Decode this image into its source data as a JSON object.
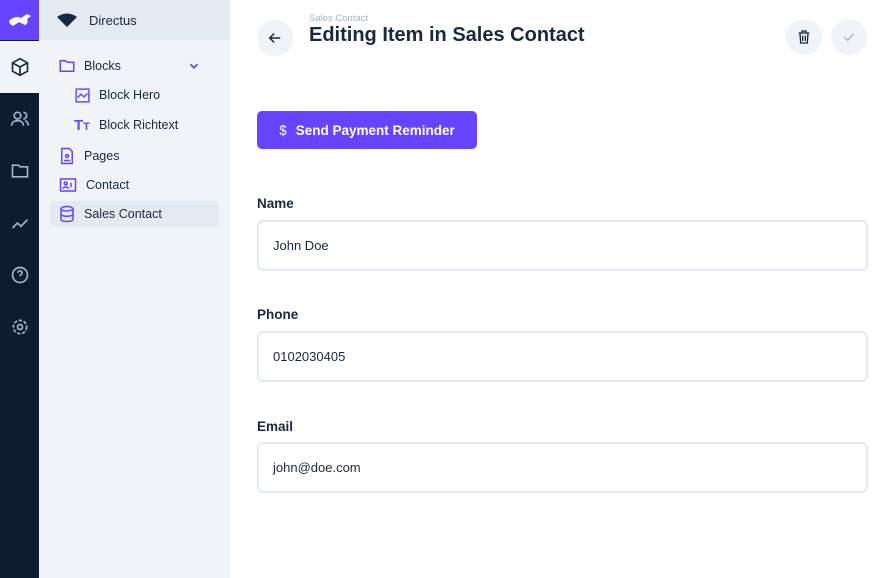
{
  "app": {
    "project_name": "Directus"
  },
  "rail": {
    "items": [
      "content",
      "user-directory",
      "files",
      "insights",
      "help",
      "settings"
    ]
  },
  "nav": {
    "items": [
      {
        "label": "Blocks",
        "icon": "folder-icon"
      },
      {
        "label": "Block Hero",
        "icon": "chart-icon"
      },
      {
        "label": "Block Richtext",
        "icon": "text-icon"
      },
      {
        "label": "Pages",
        "icon": "document-icon"
      },
      {
        "label": "Contact",
        "icon": "contact-card-icon"
      },
      {
        "label": "Sales Contact",
        "icon": "database-icon",
        "active": true
      }
    ]
  },
  "header": {
    "breadcrumb": "Sales Contact",
    "title": "Editing Item in Sales Contact"
  },
  "actions": {
    "reminder_icon": "$",
    "reminder_label": "Send Payment Reminder"
  },
  "fields": [
    {
      "label": "Name",
      "value": "John Doe"
    },
    {
      "label": "Phone",
      "value": "0102030405"
    },
    {
      "label": "Email",
      "value": "john@doe.com"
    }
  ],
  "colors": {
    "accent": "#6644ff",
    "rail": "#0e1c2f",
    "nav": "#f0f4f9"
  }
}
